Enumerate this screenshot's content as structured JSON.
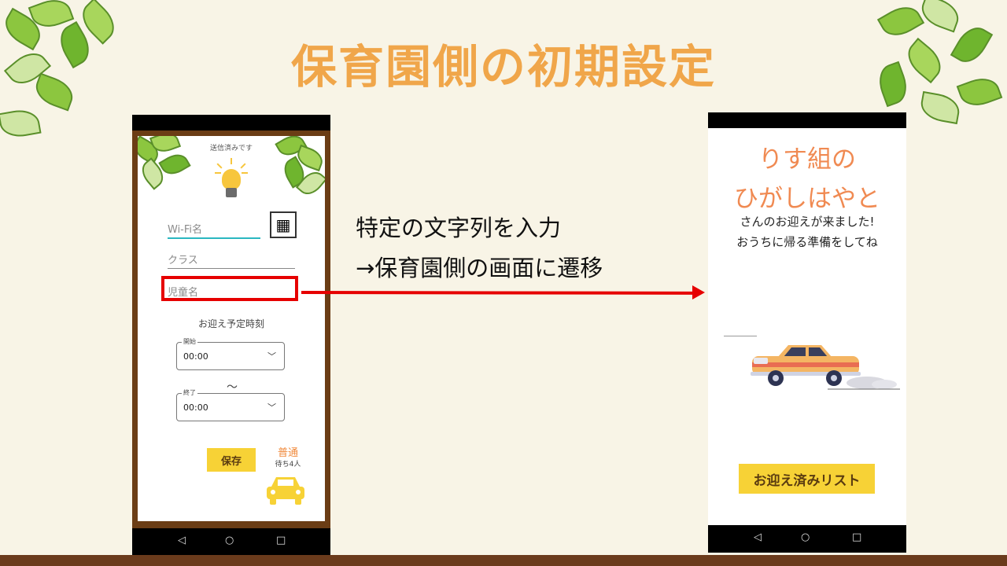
{
  "slide": {
    "title": "保育園側の初期設定",
    "caption_line1": "特定の文字列を入力",
    "caption_line2": "→保育園側の画面に遷移"
  },
  "phone_left": {
    "status_text": "送信済みです",
    "wifi_placeholder": "Wi-Fi名",
    "class_placeholder": "クラス",
    "child_placeholder": "児童名",
    "schedule_label": "お迎え予定時刻",
    "start_label": "開始",
    "start_value": "00:00",
    "end_label": "終了",
    "end_value": "00:00",
    "separator": "〜",
    "save_label": "保存",
    "congestion": "普通",
    "waiting": "待ち4人"
  },
  "phone_right": {
    "class_name": "りす組の",
    "child_name": "ひがしはやと",
    "message1": "さんのお迎えが来ました!",
    "message2": "おうちに帰る準備をしてね",
    "list_button": "お迎え済みリスト"
  },
  "nav": {
    "back": "◁",
    "home": "○",
    "recent": "□"
  },
  "colors": {
    "title": "#f0a64a",
    "accent_orange": "#f08a52",
    "button_yellow": "#f7d236",
    "highlight_red": "#e60000",
    "frame_brown": "#6b3d15"
  }
}
